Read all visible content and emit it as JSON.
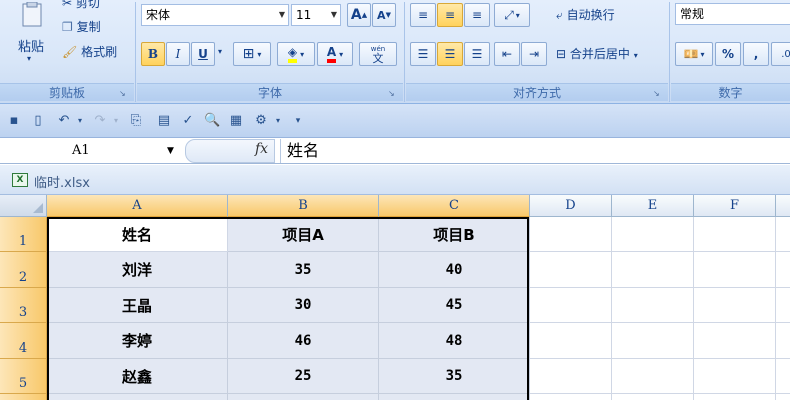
{
  "ribbon": {
    "clipboard": {
      "cut": "剪切",
      "copy": "复制",
      "format_painter": "格式刷",
      "paste": "粘贴",
      "label": "剪贴板"
    },
    "font": {
      "name": "宋体",
      "size": "11",
      "grow": "A",
      "shrink": "A",
      "bold": "B",
      "italic": "I",
      "underline": "U",
      "phonetic_char": "文",
      "phonetic_small": "wén",
      "label": "字体",
      "fill_color": "#ffff00",
      "font_color": "#ff0000"
    },
    "alignment": {
      "wrap_text": "自动换行",
      "merge_center": "合并后居中",
      "label": "对齐方式"
    },
    "number": {
      "format": "常规",
      "percent": "%",
      "comma": ",",
      "label": "数字"
    }
  },
  "qat": {
    "icons": [
      "save-icon",
      "new-icon",
      "undo-icon",
      "redo-icon",
      "format-painter-icon",
      "form-icon",
      "spelling-icon",
      "print-preview-icon",
      "border-icon",
      "tools-icon"
    ]
  },
  "formula_bar": {
    "name_box": "A1",
    "fx": "fx",
    "formula": "姓名"
  },
  "workbook": {
    "filename": "临时.xlsx"
  },
  "grid": {
    "columns": [
      "A",
      "B",
      "C",
      "D",
      "E",
      "F"
    ],
    "rows": [
      "1",
      "2",
      "3",
      "4",
      "5"
    ],
    "cells": [
      [
        "姓名",
        "项目A",
        "项目B"
      ],
      [
        "刘洋",
        "35",
        "40"
      ],
      [
        "王晶",
        "30",
        "45"
      ],
      [
        "李婷",
        "46",
        "48"
      ],
      [
        "赵鑫",
        "25",
        "35"
      ]
    ]
  },
  "colors": {
    "selection_border": "#000000",
    "selected_header": "#f8c86a"
  }
}
